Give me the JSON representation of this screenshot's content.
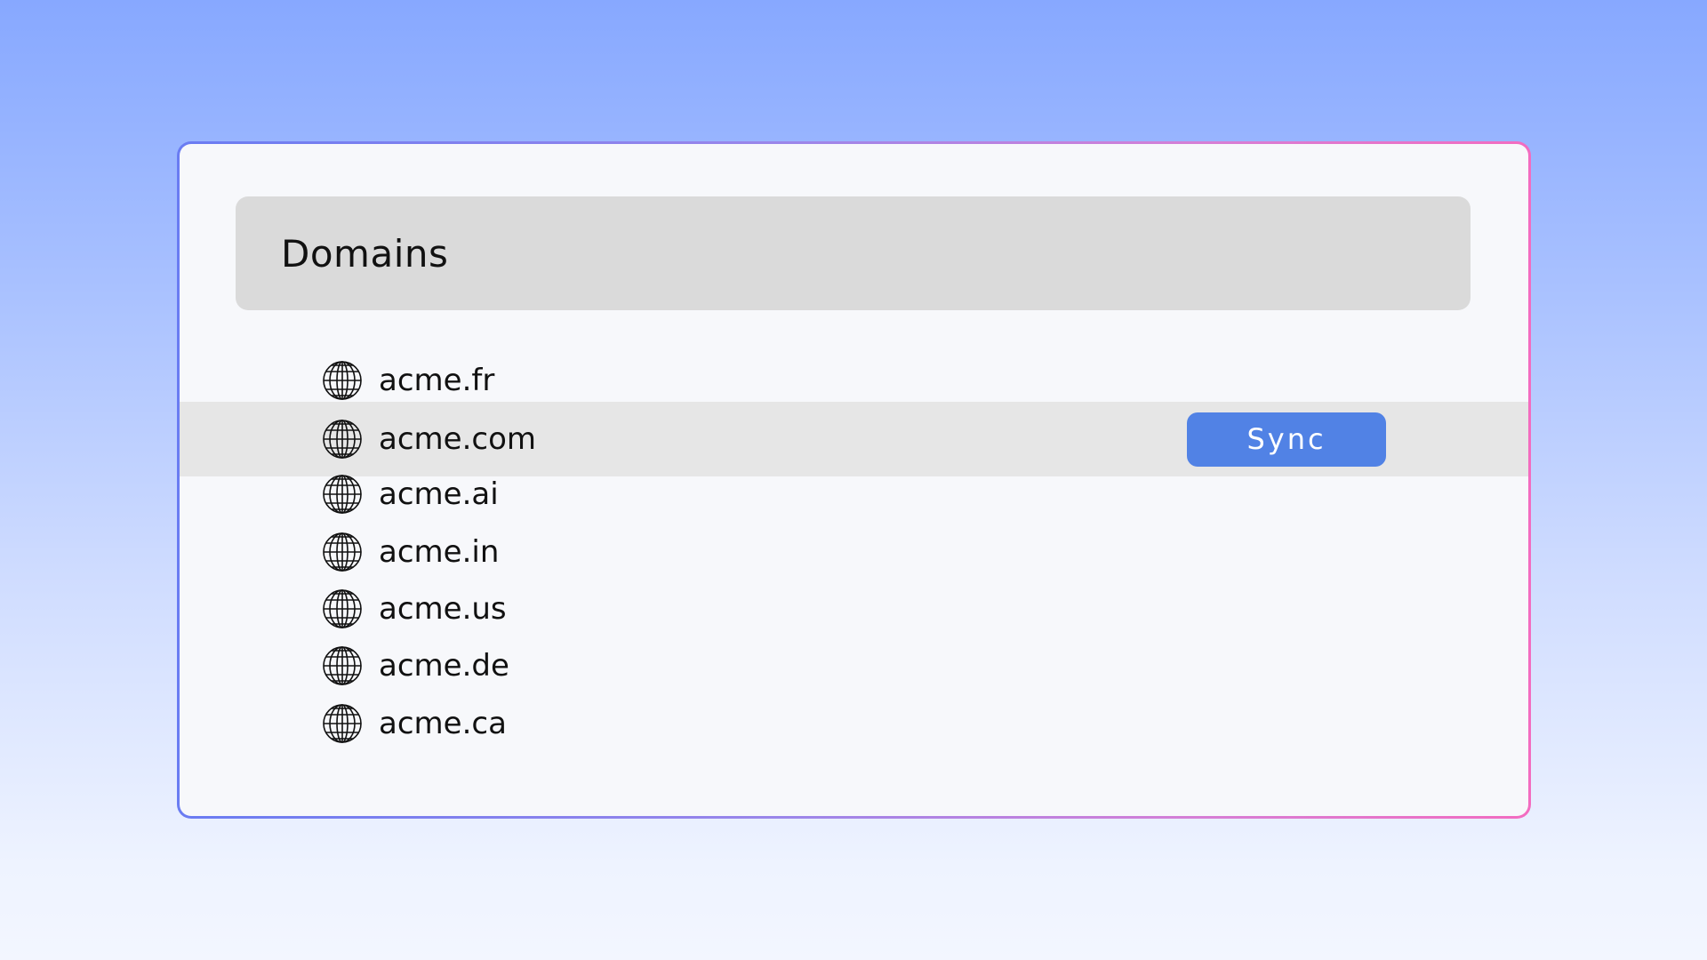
{
  "panel": {
    "title": "Domains"
  },
  "domains": [
    {
      "label": "acme.fr",
      "icon": "globe-icon"
    },
    {
      "label": "acme.com",
      "icon": "globe-icon",
      "selected": true
    },
    {
      "label": "acme.ai",
      "icon": "globe-icon"
    },
    {
      "label": "acme.in",
      "icon": "globe-icon"
    },
    {
      "label": "acme.us",
      "icon": "globe-icon"
    },
    {
      "label": "acme.de",
      "icon": "globe-icon"
    },
    {
      "label": "acme.ca",
      "icon": "globe-icon"
    }
  ],
  "actions": {
    "sync_label": "Sync"
  },
  "colors": {
    "accent": "#5182e5",
    "header_bg": "#dadada",
    "selected_row_bg": "#e6e6e6",
    "panel_bg": "#f7f8fb"
  }
}
